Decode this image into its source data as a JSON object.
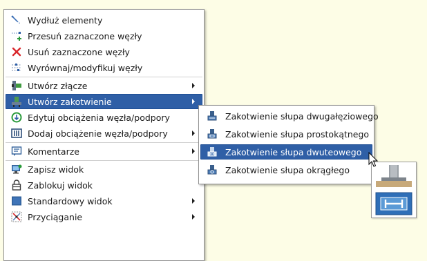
{
  "main_menu": {
    "items": [
      {
        "label": "Wydłuż elementy",
        "icon": "extend-elements-icon"
      },
      {
        "label": "Przesuń zaznaczone węzły",
        "icon": "move-nodes-icon"
      },
      {
        "label": "Usuń zaznaczone węzły",
        "icon": "delete-nodes-icon"
      },
      {
        "label": "Wyrównaj/modyfikuj węzły",
        "icon": "align-nodes-icon"
      },
      {
        "label": "Utwórz złącze",
        "icon": "connection-icon"
      },
      {
        "label": "Utwórz zakotwienie",
        "icon": "base-plate-icon"
      },
      {
        "label": "Edytuj obciążenia węzła/podpory",
        "icon": "edit-load-icon"
      },
      {
        "label": "Dodaj obciążenie węzła/podpory",
        "icon": "add-load-icon"
      },
      {
        "label": "Komentarze",
        "icon": "comment-icon"
      },
      {
        "label": "Zapisz widok",
        "icon": "save-view-icon"
      },
      {
        "label": "Zablokuj widok",
        "icon": "lock-view-icon"
      },
      {
        "label": "Standardowy widok",
        "icon": "standard-view-icon"
      },
      {
        "label": "Przyciąganie",
        "icon": "snap-icon"
      }
    ]
  },
  "submenu": {
    "items": [
      {
        "label": "Zakotwienie słupa dwugałęziowego",
        "icon": "column-base-icon"
      },
      {
        "label": "Zakotwienie słupa prostokątnego",
        "icon": "column-base-icon"
      },
      {
        "label": "Zakotwienie słupa dwuteowego",
        "icon": "column-base-icon"
      },
      {
        "label": "Zakotwienie słupa okrągłego",
        "icon": "column-base-icon"
      }
    ]
  },
  "colors": {
    "background": "#fdfde6",
    "highlight": "#2f5fa6",
    "delete_icon": "#d9262b"
  }
}
